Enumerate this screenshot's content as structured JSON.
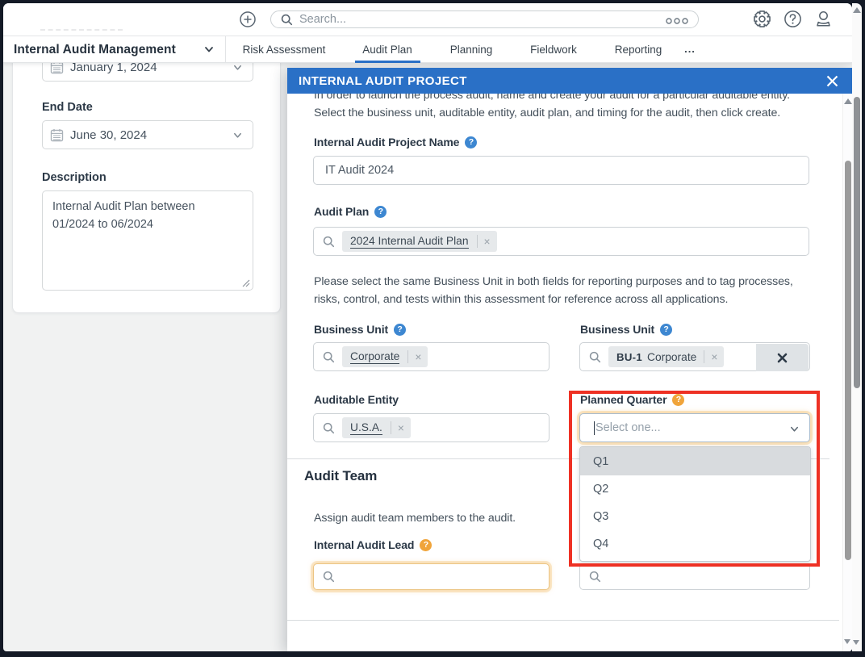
{
  "topbar": {
    "search_placeholder": "Search..."
  },
  "nav": {
    "app_title": "Internal Audit Management",
    "tabs": [
      {
        "label": "Risk Assessment",
        "active": false
      },
      {
        "label": "Audit Plan",
        "active": true
      },
      {
        "label": "Planning",
        "active": false
      },
      {
        "label": "Fieldwork",
        "active": false
      },
      {
        "label": "Reporting",
        "active": false
      }
    ],
    "more_label": "..."
  },
  "left_panel": {
    "start_date": {
      "value": "January 1, 2024"
    },
    "end_date": {
      "label": "End Date",
      "value": "June 30, 2024"
    },
    "description": {
      "label": "Description",
      "value": "Internal Audit Plan between 01/2024 to 06/2024"
    }
  },
  "modal": {
    "title": "INTERNAL AUDIT PROJECT",
    "intro_lines": [
      "In order to launch the process audit, name and create your audit for a particular auditable entity.",
      "Select the business unit, auditable entity, audit plan, and timing for the audit, then click create."
    ],
    "project_name": {
      "label": "Internal Audit Project Name",
      "value": "IT Audit 2024"
    },
    "audit_plan": {
      "label": "Audit Plan",
      "tag": "2024 Internal Audit Plan"
    },
    "note_lines": [
      "Please select the same Business Unit in both fields for reporting purposes and to tag processes,",
      "risks, control, and tests within this assessment for reference across all applications."
    ],
    "business_unit_left": {
      "label": "Business Unit",
      "tag": "Corporate"
    },
    "business_unit_right": {
      "label": "Business Unit",
      "tag_prefix": "BU-1",
      "tag": "Corporate"
    },
    "auditable_entity": {
      "label": "Auditable Entity",
      "tag": "U.S.A."
    },
    "planned_quarter": {
      "label": "Planned Quarter",
      "placeholder": "Select one...",
      "options": [
        "Q1",
        "Q2",
        "Q3",
        "Q4"
      ],
      "highlighted_option": "Q1"
    },
    "audit_team": {
      "heading": "Audit Team",
      "description": "Assign audit team members to the audit.",
      "lead_label": "Internal Audit Lead"
    }
  },
  "glyphs": {
    "help": "?",
    "tag_remove": "×"
  },
  "colors": {
    "header_blue": "#2a70c6",
    "annotation_red": "#ee3124",
    "help_blue": "#3d87d1",
    "help_orange": "#f0a43a",
    "frame": "#141a26"
  }
}
